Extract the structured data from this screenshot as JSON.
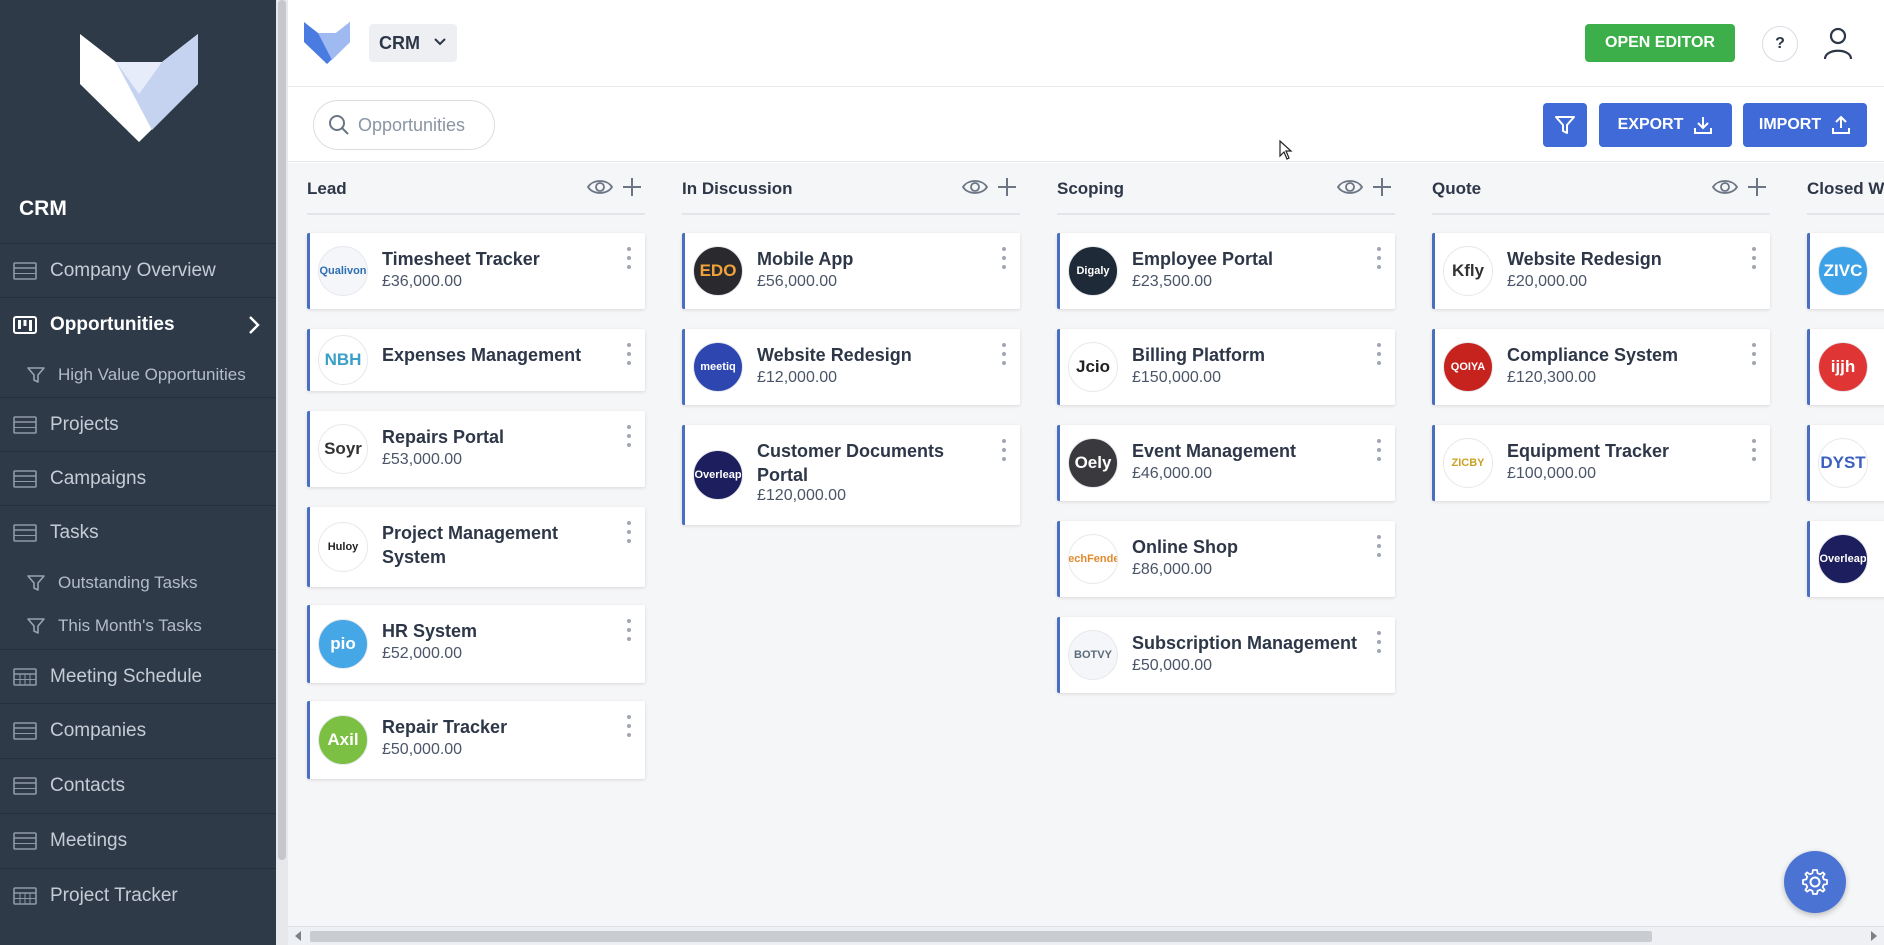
{
  "colors": {
    "sidebar_bg": "#2e3a48",
    "primary": "#3f6ad8",
    "success": "#3cae4a",
    "card_accent": "#4a6fc1",
    "board_bg": "#f5f6f8"
  },
  "sidebar": {
    "app_name": "CRM",
    "items": [
      {
        "label": "Company Overview",
        "icon": "grid-icon"
      },
      {
        "label": "Opportunities",
        "icon": "kanban-icon",
        "active": true
      },
      {
        "label": "High Value Opportunities",
        "icon": "filter-icon",
        "sub": true
      },
      {
        "label": "Projects",
        "icon": "grid-icon"
      },
      {
        "label": "Campaigns",
        "icon": "grid-icon"
      },
      {
        "label": "Tasks",
        "icon": "grid-icon"
      },
      {
        "label": "Outstanding Tasks",
        "icon": "filter-icon",
        "sub": true
      },
      {
        "label": "This Month's Tasks",
        "icon": "filter-icon",
        "sub": true
      },
      {
        "label": "Meeting Schedule",
        "icon": "calendar-icon"
      },
      {
        "label": "Companies",
        "icon": "grid-icon"
      },
      {
        "label": "Contacts",
        "icon": "grid-icon"
      },
      {
        "label": "Meetings",
        "icon": "grid-icon"
      },
      {
        "label": "Project Tracker",
        "icon": "calendar-icon"
      }
    ]
  },
  "header": {
    "app_select": "CRM",
    "open_editor": "OPEN EDITOR",
    "help": "?"
  },
  "toolbar": {
    "search_placeholder": "Opportunities",
    "export": "EXPORT",
    "import": "IMPORT"
  },
  "board": {
    "columns": [
      {
        "title": "Lead",
        "cards": [
          {
            "title": "Timesheet Tracker",
            "value": "£36,000.00",
            "logo": "Qualivon",
            "logo_bg": "#f4f6f9",
            "logo_fg": "#2c6fb3"
          },
          {
            "title": "Expenses Management",
            "value": "",
            "logo": "NBH",
            "logo_bg": "#ffffff",
            "logo_fg": "#3aa0c8"
          },
          {
            "title": "Repairs Portal",
            "value": "£53,000.00",
            "logo": "Soyr",
            "logo_bg": "#ffffff",
            "logo_fg": "#333333"
          },
          {
            "title": "Project Management System",
            "value": "",
            "logo": "Huloy",
            "logo_bg": "#ffffff",
            "logo_fg": "#222222"
          },
          {
            "title": "HR System",
            "value": "£52,000.00",
            "logo": "pio",
            "logo_bg": "#45a7e6",
            "logo_fg": "#ffffff"
          },
          {
            "title": "Repair Tracker",
            "value": "£50,000.00",
            "logo": "Axil",
            "logo_bg": "#7bc043",
            "logo_fg": "#ffffff"
          }
        ]
      },
      {
        "title": "In Discussion",
        "cards": [
          {
            "title": "Mobile App",
            "value": "£56,000.00",
            "logo": "EDO",
            "logo_bg": "#2a2a2e",
            "logo_fg": "#f2a33a"
          },
          {
            "title": "Website Redesign",
            "value": "£12,000.00",
            "logo": "meetiq",
            "logo_bg": "#2d46b0",
            "logo_fg": "#ffffff"
          },
          {
            "title": "Customer Documents Portal",
            "value": "£120,000.00",
            "logo": "Overleap",
            "logo_bg": "#1c1e5e",
            "logo_fg": "#ffffff"
          }
        ]
      },
      {
        "title": "Scoping",
        "cards": [
          {
            "title": "Employee Portal",
            "value": "£23,500.00",
            "logo": "Digaly",
            "logo_bg": "#1e2a38",
            "logo_fg": "#ffffff"
          },
          {
            "title": "Billing Platform",
            "value": "£150,000.00",
            "logo": "Jcio",
            "logo_bg": "#ffffff",
            "logo_fg": "#222222"
          },
          {
            "title": "Event Management",
            "value": "£46,000.00",
            "logo": "Oely",
            "logo_bg": "#3a3a3e",
            "logo_fg": "#ffffff"
          },
          {
            "title": "Online Shop",
            "value": "£86,000.00",
            "logo": "TechFender",
            "logo_bg": "#ffffff",
            "logo_fg": "#e2892b"
          },
          {
            "title": "Subscription Management",
            "value": "£50,000.00",
            "logo": "BOTVY",
            "logo_bg": "#f4f6f9",
            "logo_fg": "#5b6b7a"
          }
        ]
      },
      {
        "title": "Quote",
        "cards": [
          {
            "title": "Website Redesign",
            "value": "£20,000.00",
            "logo": "Kfly",
            "logo_bg": "#ffffff",
            "logo_fg": "#333333"
          },
          {
            "title": "Compliance System",
            "value": "£120,300.00",
            "logo": "QOIYA",
            "logo_bg": "#c6231e",
            "logo_fg": "#ffffff"
          },
          {
            "title": "Equipment Tracker",
            "value": "£100,000.00",
            "logo": "ZICBY",
            "logo_bg": "#ffffff",
            "logo_fg": "#c9a227"
          }
        ]
      },
      {
        "title": "Closed Won",
        "cards": [
          {
            "title": "",
            "value": "",
            "logo": "ZIVC",
            "logo_bg": "#3da1e8",
            "logo_fg": "#ffffff"
          },
          {
            "title": "",
            "value": "",
            "logo": "ijjh",
            "logo_bg": "#e03535",
            "logo_fg": "#ffffff"
          },
          {
            "title": "",
            "value": "",
            "logo": "DYST",
            "logo_bg": "#ffffff",
            "logo_fg": "#3a5fbf"
          },
          {
            "title": "",
            "value": "",
            "logo": "Overleap",
            "logo_bg": "#1c1e5e",
            "logo_fg": "#ffffff"
          }
        ]
      }
    ]
  }
}
